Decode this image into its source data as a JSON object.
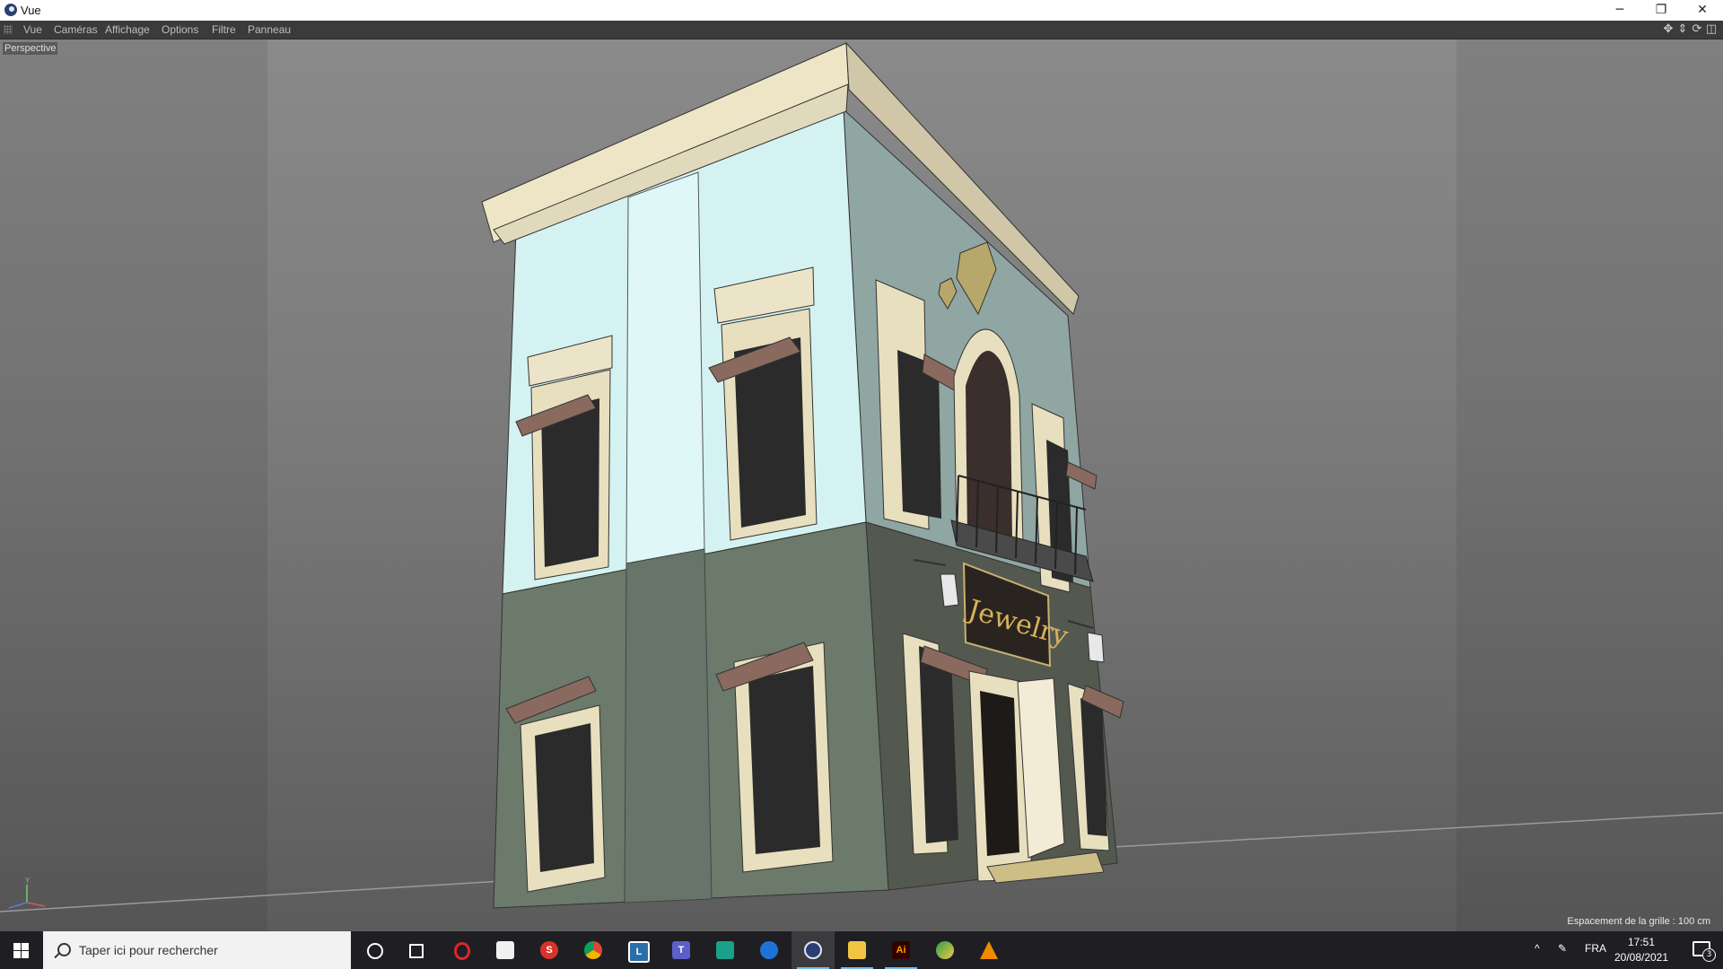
{
  "window": {
    "title": "Vue",
    "controls": {
      "minimize": "─",
      "restore": "❐",
      "close": "✕"
    }
  },
  "menubar": {
    "items": [
      "Vue",
      "Caméras",
      "Affichage",
      "Options",
      "Filtre",
      "Panneau"
    ],
    "tools": [
      "move-view-icon",
      "zoom-view-icon",
      "rotate-view-icon",
      "switch-view-icon"
    ]
  },
  "viewport": {
    "camera_label": "Perspective",
    "grid_spacing": "Espacement de la grille : 100 cm",
    "sign_text": "Jewelry",
    "axis_labels": {
      "y": "Y",
      "x": "X",
      "z": "Z"
    }
  },
  "taskbar": {
    "search_placeholder": "Taper ici pour rechercher",
    "apps": [
      {
        "name": "cortana-icon"
      },
      {
        "name": "task-view-icon"
      },
      {
        "name": "opera-icon"
      },
      {
        "name": "store-icon"
      },
      {
        "name": "app-s-icon"
      },
      {
        "name": "chrome-icon"
      },
      {
        "name": "l-app-icon"
      },
      {
        "name": "teams-icon"
      },
      {
        "name": "green-app-icon"
      },
      {
        "name": "blue-app-icon"
      },
      {
        "name": "cinema4d-icon"
      },
      {
        "name": "explorer-icon"
      },
      {
        "name": "illustrator-icon"
      },
      {
        "name": "edge-legacy-icon"
      },
      {
        "name": "vlc-icon"
      }
    ],
    "tray": {
      "language": "FRA",
      "time": "17:51",
      "date": "20/08/2021",
      "notifications": "3"
    }
  },
  "colors": {
    "wall_upper": "#d4f2f2",
    "wall_upper_side": "#8aa3a3",
    "wall_lower": "#6b7a6b",
    "trim": "#ece4c8",
    "awning": "#8a6a5e",
    "window_dark": "#2b2b2b",
    "sign_bg": "#2a2420",
    "sign_text": "#d8b25a"
  }
}
